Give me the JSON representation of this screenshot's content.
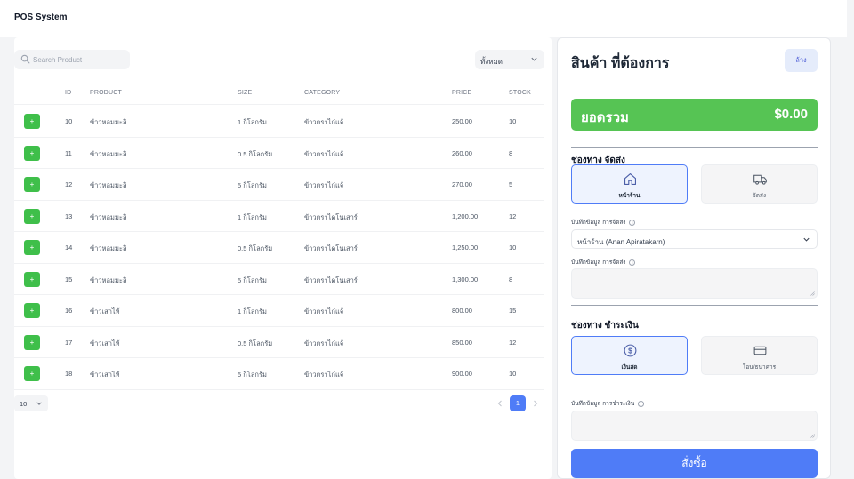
{
  "app": {
    "title": "POS System"
  },
  "products": {
    "search_placeholder": "Search Product",
    "filter_value": "ทั้งหมด",
    "columns": {
      "id": "ID",
      "product": "PRODUCT",
      "size": "SIZE",
      "category": "CATEGORY",
      "price": "PRICE",
      "stock": "STOCK"
    },
    "add_label": "+",
    "rows": [
      {
        "id": "10",
        "product": "ข้าวหอมมะลิ",
        "size": "1 กิโลกรัม",
        "category": "ข้าวตราไก่แจ้",
        "price": "250.00",
        "stock": "10"
      },
      {
        "id": "11",
        "product": "ข้าวหอมมะลิ",
        "size": "0.5 กิโลกรัม",
        "category": "ข้าวตราไก่แจ้",
        "price": "260.00",
        "stock": "8"
      },
      {
        "id": "12",
        "product": "ข้าวหอมมะลิ",
        "size": "5 กิโลกรัม",
        "category": "ข้าวตราไก่แจ้",
        "price": "270.00",
        "stock": "5"
      },
      {
        "id": "13",
        "product": "ข้าวหอมมะลิ",
        "size": "1 กิโลกรัม",
        "category": "ข้าวตราไดโนเสาร์",
        "price": "1,200.00",
        "stock": "12"
      },
      {
        "id": "14",
        "product": "ข้าวหอมมะลิ",
        "size": "0.5 กิโลกรัม",
        "category": "ข้าวตราไดโนเสาร์",
        "price": "1,250.00",
        "stock": "10"
      },
      {
        "id": "15",
        "product": "ข้าวหอมมะลิ",
        "size": "5 กิโลกรัม",
        "category": "ข้าวตราไดโนเสาร์",
        "price": "1,300.00",
        "stock": "8"
      },
      {
        "id": "16",
        "product": "ข้าวเสาไห้",
        "size": "1 กิโลกรัม",
        "category": "ข้าวตราไก่แจ้",
        "price": "800.00",
        "stock": "15"
      },
      {
        "id": "17",
        "product": "ข้าวเสาไห้",
        "size": "0.5 กิโลกรัม",
        "category": "ข้าวตราไก่แจ้",
        "price": "850.00",
        "stock": "12"
      },
      {
        "id": "18",
        "product": "ข้าวเสาไห้",
        "size": "5 กิโลกรัม",
        "category": "ข้าวตราไก่แจ้",
        "price": "900.00",
        "stock": "10"
      }
    ],
    "page_size": "10",
    "current_page": "1"
  },
  "cart": {
    "title": "สินค้า ที่ต้องการ",
    "clear_label": "ล้าง",
    "total_label": "ยอดรวม",
    "total_amount": "$0.00",
    "delivery": {
      "title": "ช่องทาง จัดส่ง",
      "options": [
        {
          "label": "หน้าร้าน",
          "icon": "home-icon"
        },
        {
          "label": "จัดส่ง",
          "icon": "truck-icon"
        }
      ],
      "address_label": "บันทึกข้อมูล การจัดส่ง",
      "address_value": "หน้าร้าน (Anan Apiratakarn)",
      "note_label": "บันทึกข้อมูล การจัดส่ง"
    },
    "payment": {
      "title": "ช่องทาง ชำระเงิน",
      "options": [
        {
          "label": "เงินสด",
          "icon": "dollar-icon"
        },
        {
          "label": "โอน/ธนาคาร",
          "icon": "credit-card-icon"
        }
      ],
      "note_label": "บันทึกข้อมูล การชำระเงิน"
    },
    "order_label": "สั่งซื้อ"
  },
  "colors": {
    "accent": "#4f7cf7",
    "success": "#56c454",
    "add_button": "#3fbf4a"
  }
}
